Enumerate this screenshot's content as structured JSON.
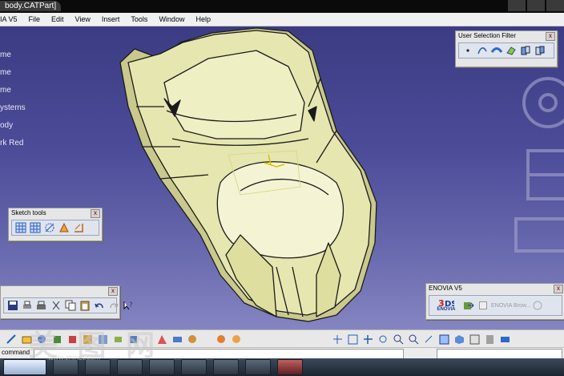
{
  "window": {
    "title": "body.CATPart]"
  },
  "menubar": {
    "items": [
      {
        "label": "IA V5"
      },
      {
        "label": "File"
      },
      {
        "label": "Edit"
      },
      {
        "label": "View"
      },
      {
        "label": "Insert"
      },
      {
        "label": "Tools"
      },
      {
        "label": "Window"
      },
      {
        "label": "Help"
      }
    ]
  },
  "spec_tree": {
    "items": [
      "me",
      "me",
      "me",
      "ystems",
      "ody",
      "rk Red"
    ]
  },
  "toolbars": {
    "user_selection_filter": {
      "title": "User Selection Filter",
      "close": "x"
    },
    "sketch_tools": {
      "title": "Sketch tools",
      "close": "x"
    },
    "standard": {
      "close": "x"
    },
    "enovia": {
      "title": "ENOVIA V5",
      "close": "x",
      "logo_text": "ENOVIA",
      "disabled_label": "ENOVIA Brow..."
    }
  },
  "command_line": {
    "label": "command",
    "value": ""
  },
  "watermark": {
    "text": "美 图 网",
    "sub": "www.zhinet.com"
  },
  "colors": {
    "viewport_top": "#3c3c84",
    "viewport_bottom": "#8585c2",
    "model_fill": "#e6e6b0",
    "model_edge": "#1a1a1a"
  }
}
